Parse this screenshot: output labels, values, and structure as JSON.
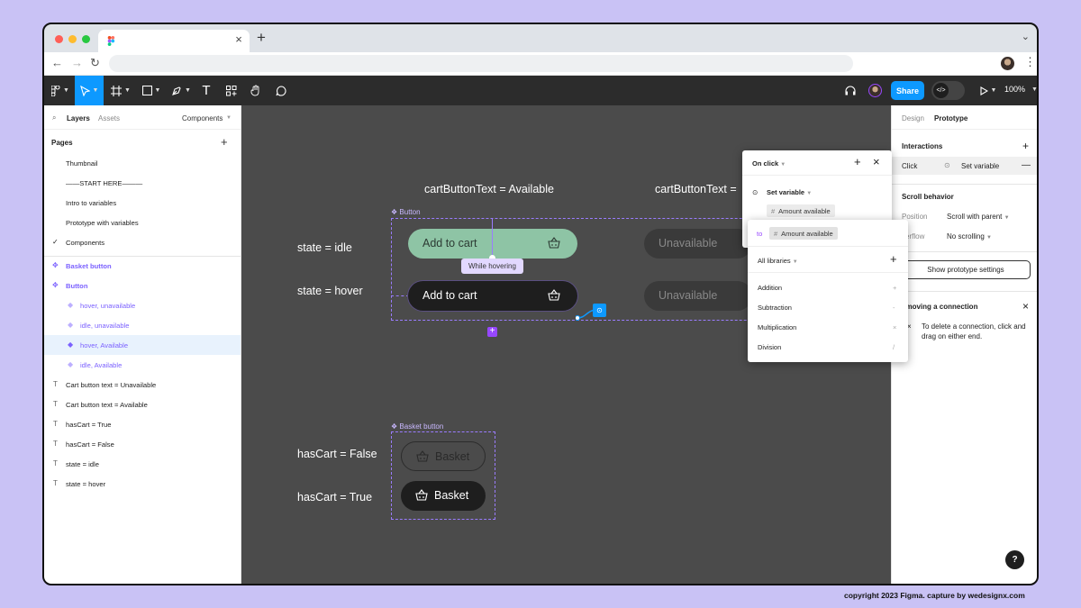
{
  "browser": {
    "new_tab": "+",
    "close_tab": "×"
  },
  "toolbar": {
    "share_label": "Share",
    "zoom_label": "100%"
  },
  "left_panel": {
    "tabs": [
      "Layers",
      "Assets"
    ],
    "components_label": "Components",
    "pages_heading": "Pages",
    "pages": [
      "Thumbnail",
      "——START HERE———",
      "Intro to variables",
      "Prototype with variables",
      "Components"
    ],
    "layers": [
      "Basket button",
      "Button",
      "hover, unavailable",
      "idle, unavailable",
      "hover, Available",
      "idle, Available",
      "Cart button text = Unavailable",
      "Cart button text = Available",
      "hasCart = True",
      "hasCart = False",
      "state = idle",
      "state = hover"
    ]
  },
  "canvas": {
    "label_available": "cartButtonText = Available",
    "label_unavailable": "cartButtonText =",
    "label_state_idle": "state = idle",
    "label_state_hover": "state = hover",
    "button_tag": "Button",
    "basket_tag": "Basket button",
    "add_to_cart": "Add to cart",
    "unavailable": "Unavailable",
    "while_hovering": "While hovering",
    "hascart_false": "hasCart = False",
    "hascart_true": "hasCart = True",
    "basket": "Basket"
  },
  "interaction_popup": {
    "trigger": "On click",
    "action": "Set variable",
    "variable": "Amount available",
    "to_label": "to",
    "to_value": "Amount available"
  },
  "variable_picker": {
    "library": "All libraries",
    "operations": [
      {
        "name": "Addition",
        "symbol": "+"
      },
      {
        "name": "Subtraction",
        "symbol": "-"
      },
      {
        "name": "Multiplication",
        "symbol": "×"
      },
      {
        "name": "Division",
        "symbol": "/"
      }
    ]
  },
  "right_panel": {
    "tab_design": "Design",
    "tab_prototype": "Prototype",
    "interactions_heading": "Interactions",
    "interaction_trigger": "Click",
    "interaction_action": "Set variable",
    "scroll_heading": "Scroll behavior",
    "position_label": "Position",
    "position_value": "Scroll with parent",
    "overflow_label": "verflow",
    "overflow_value": "No scrolling",
    "show_settings": "Show prototype settings",
    "removing_heading": "emoving a connection",
    "removing_text_1": "To delete a connection, click and",
    "removing_text_2": "drag on either end.",
    "help": "?"
  },
  "footer": "copyright 2023 Figma. capture by wedesignx.com",
  "colors": {
    "accent": "#0d99ff",
    "component_purple": "#7b61ff",
    "available_green": "#8ec4a5",
    "canvas": "#4b4b4b"
  }
}
